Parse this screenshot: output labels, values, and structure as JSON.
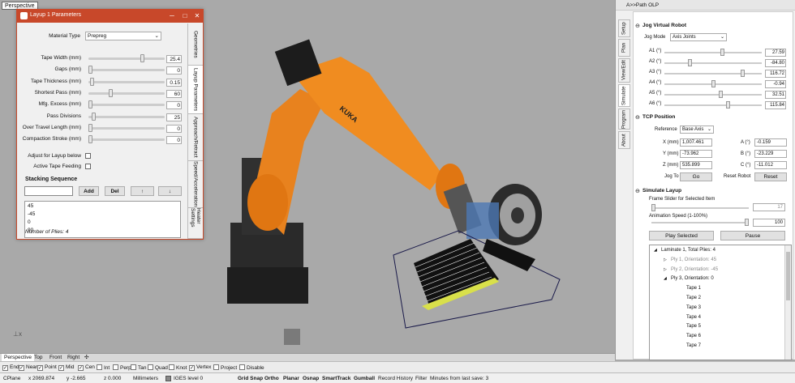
{
  "viewport": {
    "title": "Perspective"
  },
  "layup_window": {
    "title": "Layup 1 Parameters",
    "material_type": {
      "label": "Material Type",
      "value": "Prepreg"
    },
    "params": [
      {
        "label": "Tape Width (mm)",
        "value": "25.4",
        "level": 0.72
      },
      {
        "label": "Gaps (mm)",
        "value": "0",
        "level": 0.0
      },
      {
        "label": "Tape Thickness (mm)",
        "value": "0.15",
        "level": 0.02
      },
      {
        "label": "Shortest Pass (mm)",
        "value": "60",
        "level": 0.28
      },
      {
        "label": "Mfg. Excess (mm)",
        "value": "0",
        "level": 0.0
      },
      {
        "label": "Pass Divisions",
        "value": "25",
        "level": 0.05
      },
      {
        "label": "Over Travel Length (mm)",
        "value": "0",
        "level": 0.0
      },
      {
        "label": "Compaction Stroke (mm)",
        "value": "0",
        "level": 0.0
      }
    ],
    "adjust_label": "Adjust for Layup below",
    "active_feed_label": "Active Tape Feeding",
    "stacking_title": "Stacking Sequence",
    "add_label": "Add",
    "del_label": "Del",
    "up_label": "↑",
    "down_label": "↓",
    "sequence": [
      "45",
      "-45",
      "0",
      "90"
    ],
    "plies_count": "Number of Plies: 4",
    "side_tabs": [
      "Geometries",
      "Layup Parameters",
      "Approach/Retract",
      "Speed/Acceleration",
      "Heater Settings"
    ]
  },
  "right_panel": {
    "header": "A>>Path OLP",
    "tabs": [
      "Setup",
      "Plan",
      "View/Edit",
      "Simulate",
      "Program",
      "About"
    ],
    "jog": {
      "title": "Jog Virtual Robot",
      "mode_label": "Jog Mode",
      "mode_value": "Axis Joints",
      "axes": [
        {
          "label": "A1 (°)",
          "value": "27.59",
          "level": 0.6
        },
        {
          "label": "A2 (°)",
          "value": "-84.80",
          "level": 0.25
        },
        {
          "label": "A3 (°)",
          "value": "116.72",
          "level": 0.82
        },
        {
          "label": "A4 (°)",
          "value": "-0.94",
          "level": 0.5
        },
        {
          "label": "A5 (°)",
          "value": "32.51",
          "level": 0.58
        },
        {
          "label": "A6 (°)",
          "value": "115.84",
          "level": 0.66
        }
      ]
    },
    "tcp": {
      "title": "TCP Position",
      "ref_label": "Reference",
      "ref_value": "Base Axis",
      "x_label": "X (mm)",
      "x": "1,007.461",
      "y_label": "Y (mm)",
      "y": "-73.962",
      "z_label": "Z (mm)",
      "z": "535.899",
      "a_label": "A (°)",
      "a": "-0.159",
      "b_label": "B (°)",
      "b": "-23.229",
      "c_label": "C (°)",
      "c": "-11.012",
      "jog_to_label": "Jog To",
      "go_label": "Go",
      "reset_robot_label": "Reset Robot",
      "reset_label": "Reset"
    },
    "simulate": {
      "title": "Simulate Layup",
      "frame_label": "Frame Slider for Selected Item",
      "frame_value": "17",
      "speed_label": "Animation Speed (1-100%)",
      "speed_value": "100",
      "play_label": "Play Selected",
      "pause_label": "Pause"
    },
    "tree": [
      {
        "text": "Laminate 1, Total Plies: 4",
        "indent": 0,
        "mark": "◢",
        "dim": false
      },
      {
        "text": "Ply 1, Orientation: 45",
        "indent": 1,
        "mark": "▷",
        "dim": true
      },
      {
        "text": "Ply 2, Orientation: -45",
        "indent": 1,
        "mark": "▷",
        "dim": true
      },
      {
        "text": "Ply 3, Orientation: 0",
        "indent": 1,
        "mark": "◢",
        "dim": false
      },
      {
        "text": "Tape 1",
        "indent": 2,
        "mark": "",
        "dim": false
      },
      {
        "text": "Tape 2",
        "indent": 2,
        "mark": "",
        "dim": false
      },
      {
        "text": "Tape 3",
        "indent": 2,
        "mark": "",
        "dim": false
      },
      {
        "text": "Tape 4",
        "indent": 2,
        "mark": "",
        "dim": false
      },
      {
        "text": "Tape 5",
        "indent": 2,
        "mark": "",
        "dim": false
      },
      {
        "text": "Tape 6",
        "indent": 2,
        "mark": "",
        "dim": false
      },
      {
        "text": "Tape 7",
        "indent": 2,
        "mark": "",
        "dim": false
      }
    ]
  },
  "viewport_tabs": [
    "Perspective",
    "Top",
    "Front",
    "Right"
  ],
  "osnap": [
    {
      "label": "End",
      "checked": true
    },
    {
      "label": "Near",
      "checked": true
    },
    {
      "label": "Point",
      "checked": true
    },
    {
      "label": "Mid",
      "checked": true
    },
    {
      "label": "Cen",
      "checked": true
    },
    {
      "label": "Int",
      "checked": false
    },
    {
      "label": "Perp",
      "checked": false
    },
    {
      "label": "Tan",
      "checked": false
    },
    {
      "label": "Quad",
      "checked": false
    },
    {
      "label": "Knot",
      "checked": false
    },
    {
      "label": "Vertex",
      "checked": true
    },
    {
      "label": "Project",
      "checked": false
    },
    {
      "label": "Disable",
      "checked": false
    }
  ],
  "status": {
    "cplane": "CPlane",
    "x": "x 2069.874",
    "y": "y -2.665",
    "z": "z 0.000",
    "units": "Millimeters",
    "layer": "IGES level 0",
    "toggles": [
      "Grid Snap",
      "Ortho",
      "Planar",
      "Osnap",
      "SmartTrack",
      "Gumball",
      "Record History",
      "Filter"
    ],
    "save_msg": "Minutes from last save: 3"
  },
  "colors": {
    "accent": "#c8482a",
    "robot_orange": "#e8821e",
    "viewport_bg": "#a9a9a9"
  }
}
